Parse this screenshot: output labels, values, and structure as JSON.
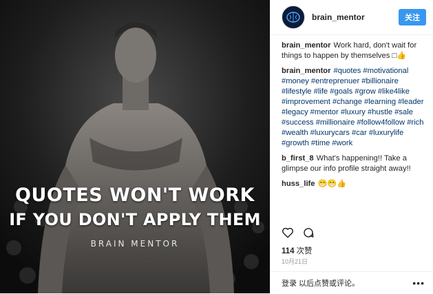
{
  "photo": {
    "quote_line1": "QUOTES WON'T WORK",
    "quote_line2": "IF YOU DON'T APPLY THEM",
    "brand": "BRAIN MENTOR"
  },
  "header": {
    "username": "brain_mentor",
    "follow_label": "关注",
    "avatar_icon": "brain-logo-icon"
  },
  "comments": [
    {
      "user": "brain_mentor",
      "text": "Work hard, don't wait for things to happen by themselves □👍"
    },
    {
      "user": "brain_mentor",
      "text": "#quotes #motivational #money #entreprenuer #billionaire #lifestyle #life #goals #grow #like4like #improvement #change #learning #leader #legacy #mentor #luxury #hustle #sale #success #millionaire #follow4follow #rich #wealth #luxurycars #car #luxurylife #growth #time #work"
    },
    {
      "user": "b_first_8",
      "text": "What's happening!! Take a glimpse our info profile straight away!!"
    },
    {
      "user": "huss_life",
      "text": "😁😁👍"
    }
  ],
  "actions": {
    "like_icon": "heart-icon",
    "comment_icon": "comment-icon"
  },
  "likes": {
    "count": "114",
    "label": "次赞"
  },
  "date": "10月21日",
  "footer": {
    "login_prompt": "登录 以后点赞或评论。",
    "more": "•••"
  },
  "colors": {
    "follow_button": "#3897f0",
    "hashtag": "#003569"
  }
}
